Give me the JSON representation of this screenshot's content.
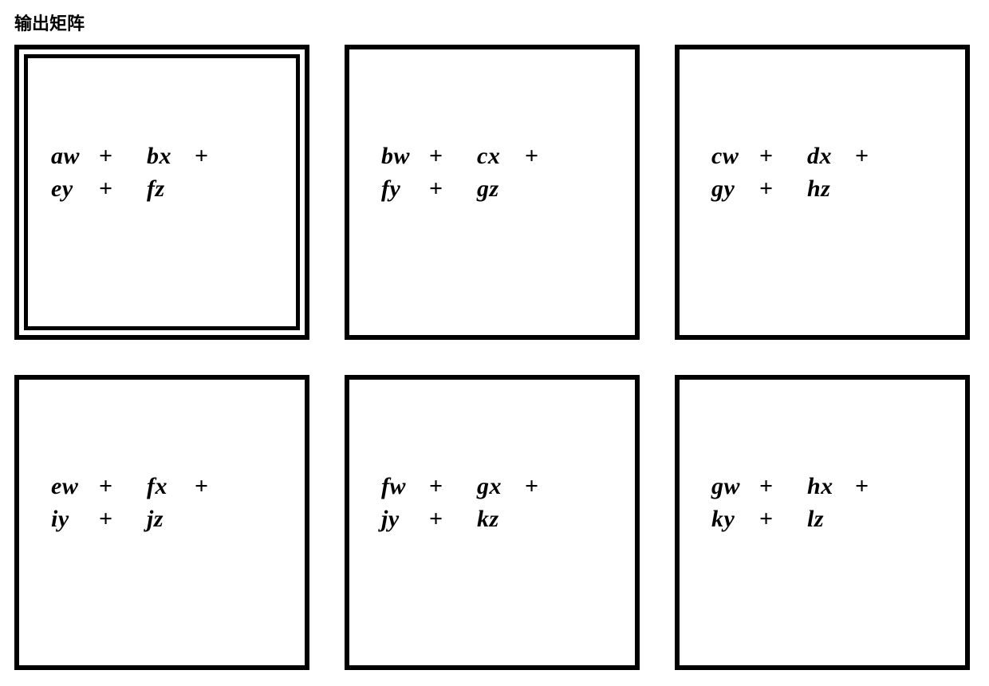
{
  "title": "输出矩阵",
  "cells": [
    {
      "highlighted": true,
      "r1": [
        "aw",
        "bx"
      ],
      "r2": [
        "ey",
        "fz"
      ]
    },
    {
      "highlighted": false,
      "r1": [
        "bw",
        "cx"
      ],
      "r2": [
        "fy",
        "gz"
      ]
    },
    {
      "highlighted": false,
      "r1": [
        "cw",
        "dx"
      ],
      "r2": [
        "gy",
        "hz"
      ]
    },
    {
      "highlighted": false,
      "r1": [
        "ew",
        "fx"
      ],
      "r2": [
        "iy",
        "jz"
      ]
    },
    {
      "highlighted": false,
      "r1": [
        "fw",
        "gx"
      ],
      "r2": [
        "jy",
        "kz"
      ]
    },
    {
      "highlighted": false,
      "r1": [
        "gw",
        "hx"
      ],
      "r2": [
        "ky",
        "lz"
      ]
    }
  ],
  "chart_data": {
    "type": "table",
    "title": "输出矩阵",
    "rows": 2,
    "cols": 3,
    "cells": [
      [
        "aw + bx + ey + fz",
        "bw + cx + fy + gz",
        "cw + dx + gy + hz"
      ],
      [
        "ew + fx + iy + jz",
        "fw + gx + jy + kz",
        "gw + hx + ky + lz"
      ]
    ],
    "highlighted_cell": [
      0,
      0
    ]
  }
}
